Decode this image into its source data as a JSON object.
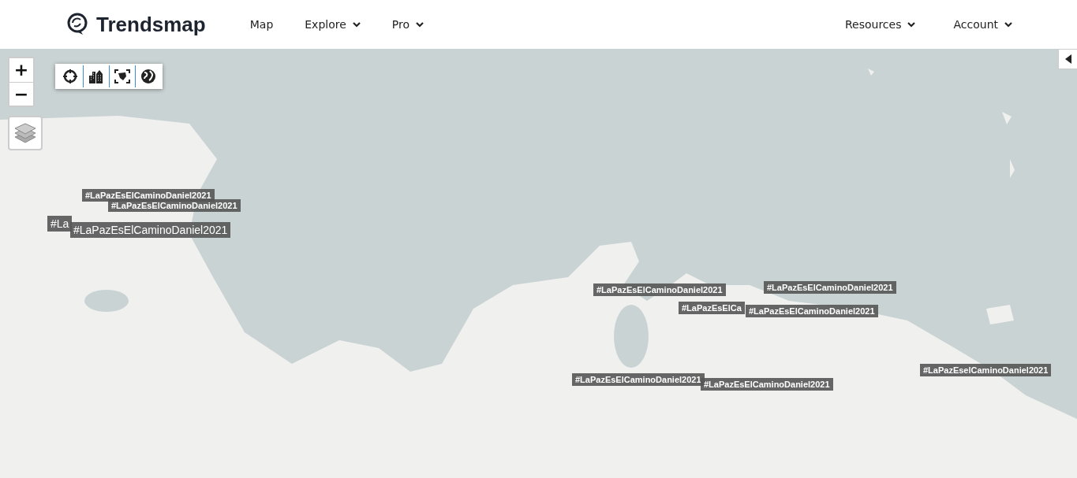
{
  "header": {
    "brand": "Trendsmap",
    "nav_left": [
      {
        "label": "Map",
        "has_menu": false
      },
      {
        "label": "Explore",
        "has_menu": true
      },
      {
        "label": "Pro",
        "has_menu": true
      }
    ],
    "nav_right": [
      {
        "label": "Resources",
        "has_menu": true
      },
      {
        "label": "Account",
        "has_menu": true
      }
    ]
  },
  "map": {
    "zoom_in": "+",
    "zoom_out": "−",
    "tools": [
      {
        "kind": "locate"
      },
      {
        "kind": "city"
      },
      {
        "kind": "region"
      },
      {
        "kind": "world"
      }
    ],
    "trend_labels": [
      {
        "text": "#LaPazEsElCaminoDaniel2021",
        "kind": "small"
      },
      {
        "text": "#LaPazEsElCaminoDaniel2021",
        "kind": "small"
      },
      {
        "text": "#La",
        "kind": "large"
      },
      {
        "text": "#LaPazEsElCaminoDaniel2021",
        "kind": "large"
      },
      {
        "text": "#LaPazEsElCaminoDaniel2021",
        "kind": "small"
      },
      {
        "text": "#LaPazEsElCaminoDaniel2021",
        "kind": "small"
      },
      {
        "text": "#LaPazEsElCa",
        "kind": "small"
      },
      {
        "text": "#LaPazEsElCaminoDaniel2021",
        "kind": "small"
      },
      {
        "text": "#LaPazEsElCaminoDaniel2021",
        "kind": "small"
      },
      {
        "text": "#LaPazEsElCaminoDaniel2021",
        "kind": "small"
      },
      {
        "text": "#LaPazEselCaminoDaniel2021",
        "kind": "small"
      }
    ]
  }
}
